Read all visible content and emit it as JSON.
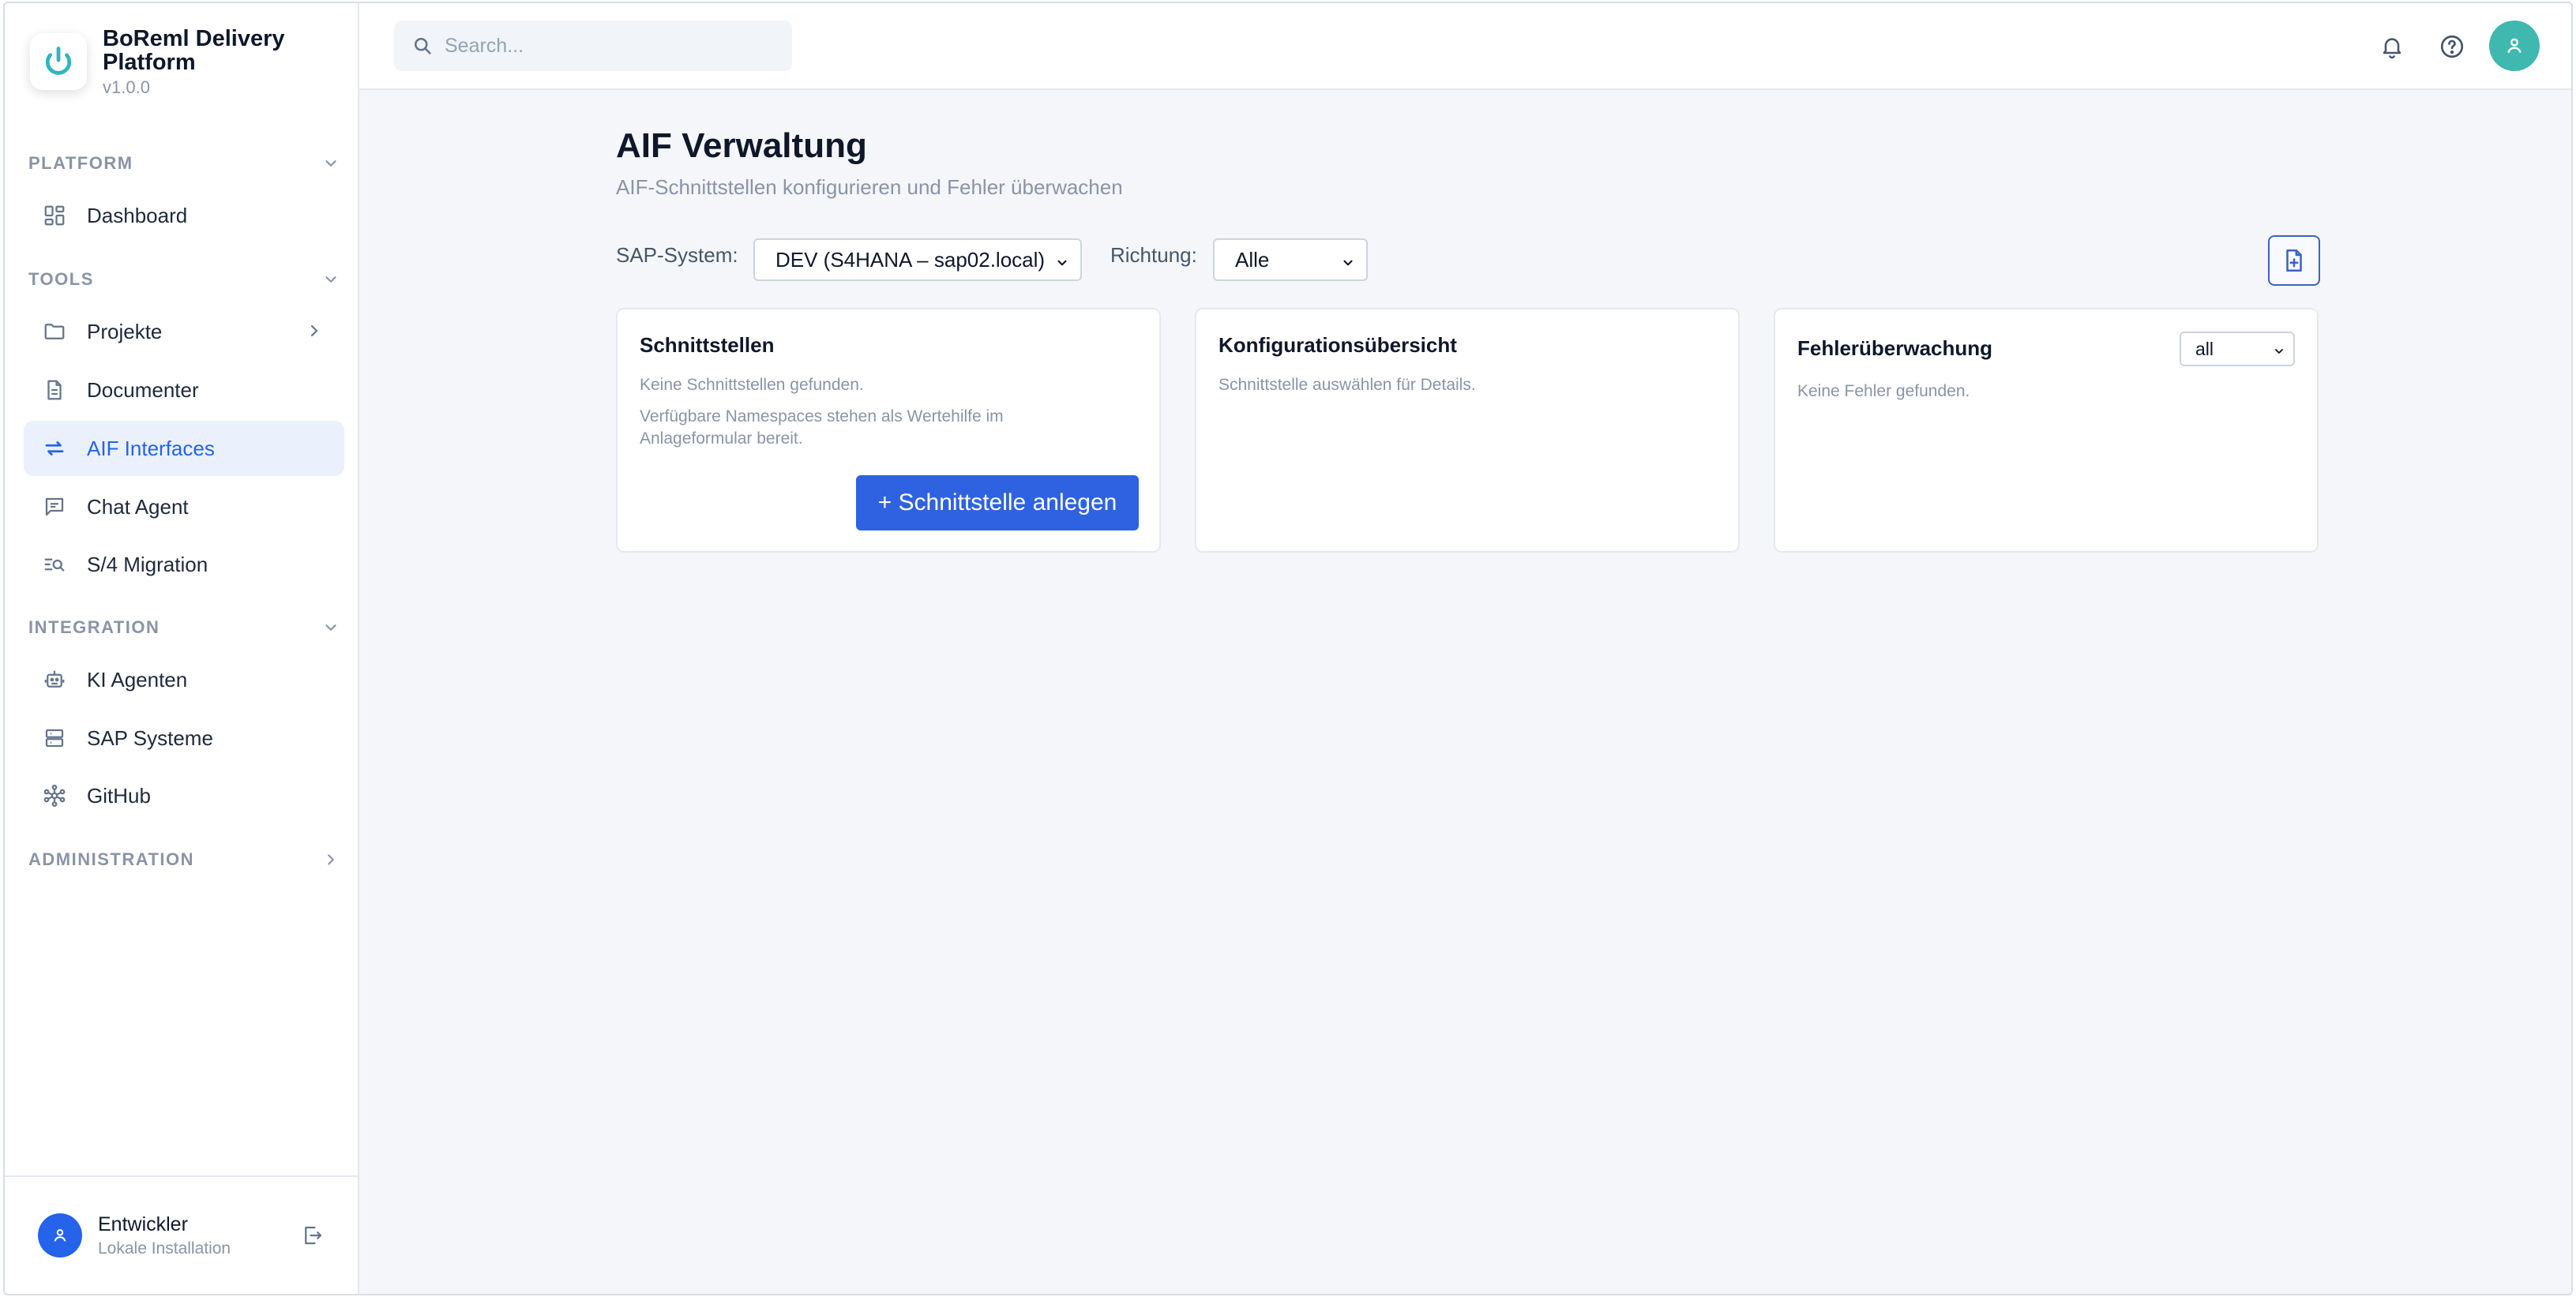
{
  "app": {
    "name": "BoReml Delivery Platform",
    "version": "v1.0.0"
  },
  "sidebar": {
    "sections": [
      {
        "title": "PLATFORM",
        "items": [
          {
            "label": "Dashboard",
            "icon": "dashboard-icon"
          }
        ]
      },
      {
        "title": "TOOLS",
        "items": [
          {
            "label": "Projekte",
            "icon": "folder-icon"
          },
          {
            "label": "Documenter",
            "icon": "document-icon"
          },
          {
            "label": "AIF Interfaces",
            "icon": "arrows-exchange-icon",
            "active": true
          },
          {
            "label": "Chat Agent",
            "icon": "chat-icon"
          },
          {
            "label": "S/4 Migration",
            "icon": "search-list-icon"
          }
        ]
      },
      {
        "title": "INTEGRATION",
        "items": [
          {
            "label": "KI Agenten",
            "icon": "robot-icon"
          },
          {
            "label": "SAP Systeme",
            "icon": "server-icon"
          },
          {
            "label": "GitHub",
            "icon": "network-icon"
          }
        ]
      },
      {
        "title": "ADMINISTRATION",
        "items": []
      }
    ],
    "footer": {
      "name": "Entwickler",
      "subtitle": "Lokale Installation"
    }
  },
  "topbar": {
    "search_placeholder": "Search..."
  },
  "page": {
    "title": "AIF Verwaltung",
    "subtitle": "AIF-Schnittstellen konfigurieren und Fehler überwachen"
  },
  "filters": {
    "sap_system_label": "SAP-System:",
    "sap_system_value": "DEV (S4HANA – sap02.local)",
    "direction_label": "Richtung:",
    "direction_value": "Alle"
  },
  "cards": {
    "interfaces": {
      "title": "Schnittstellen",
      "empty": "Keine Schnittstellen gefunden.",
      "hint": "Verfügbare Namespaces stehen als Wertehilfe im Anlageformular bereit.",
      "create_button": "+ Schnittstelle anlegen"
    },
    "config": {
      "title": "Konfigurationsübersicht",
      "empty": "Schnittstelle auswählen für Details."
    },
    "errors": {
      "title": "Fehlerüberwachung",
      "filter_value": "all",
      "empty": "Keine Fehler gefunden."
    }
  },
  "colors": {
    "accent": "#2563eb",
    "primary_button": "#2f62e0",
    "active_nav_bg": "#eaf1fd",
    "avatar_teal": "#3fb8b0",
    "logo_teal": "#2fb5c2"
  }
}
